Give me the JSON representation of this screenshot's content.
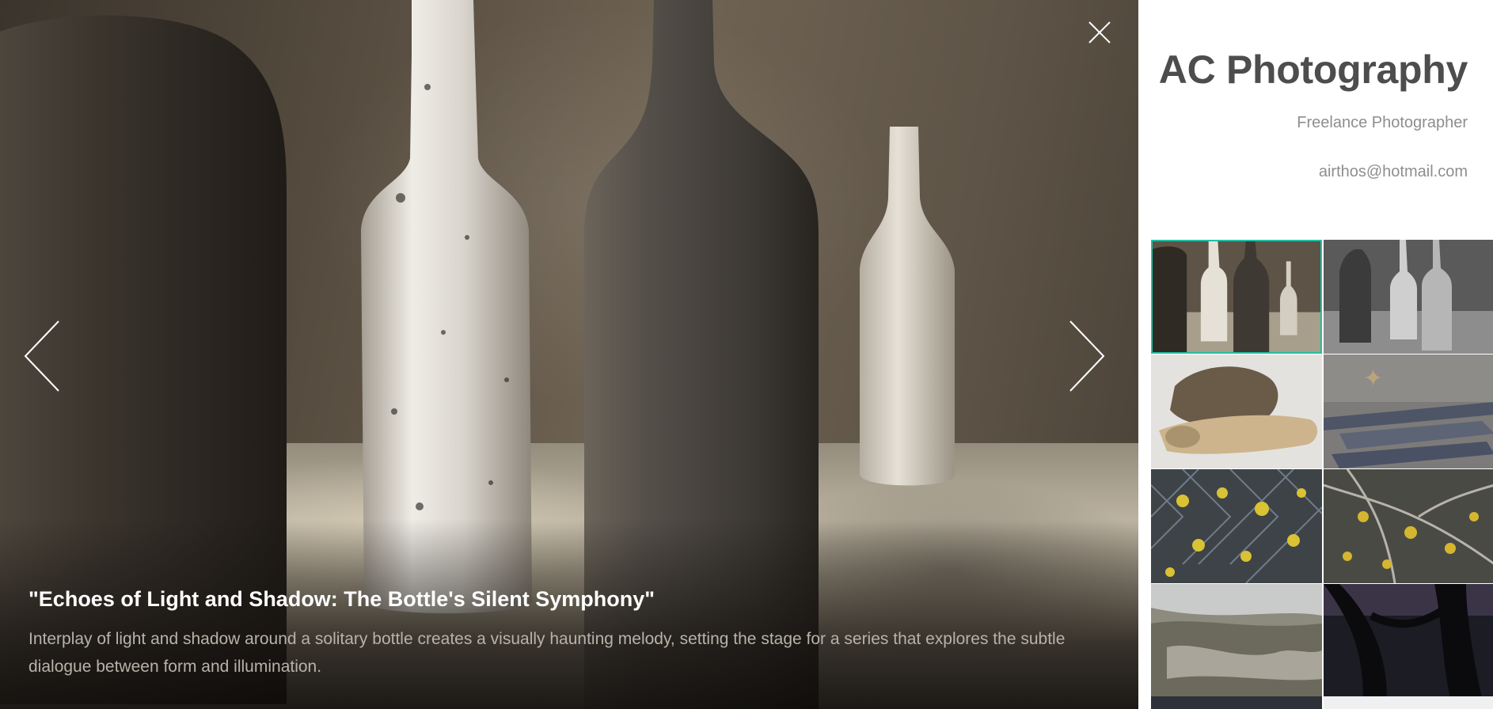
{
  "viewer": {
    "caption_title": "\"Echoes of Light and Shadow: The Bottle's Silent Symphony\"",
    "caption_description": "Interplay of light and shadow around a solitary bottle creates a visually haunting melody, setting the stage for a series that explores the subtle dialogue between form and illumination.",
    "close_icon": "close-icon",
    "prev_icon": "chevron-left-icon",
    "next_icon": "chevron-right-icon"
  },
  "sidebar": {
    "brand_name": "AC Photography",
    "tagline": "Freelance Photographer",
    "email": "airthos@hotmail.com",
    "accent_color": "#1fc1a3",
    "thumbnails": [
      {
        "subject": "bottles-color",
        "active": true
      },
      {
        "subject": "bottles-grayscale",
        "active": false
      },
      {
        "subject": "driftwood-bone",
        "active": false
      },
      {
        "subject": "graffiti-concrete",
        "active": false
      },
      {
        "subject": "chain-link-yellow-leaves",
        "active": false
      },
      {
        "subject": "branches-yellow-leaves",
        "active": false
      },
      {
        "subject": "rocky-hillside",
        "active": false
      },
      {
        "subject": "dark-tree-silhouette",
        "active": false
      }
    ]
  }
}
